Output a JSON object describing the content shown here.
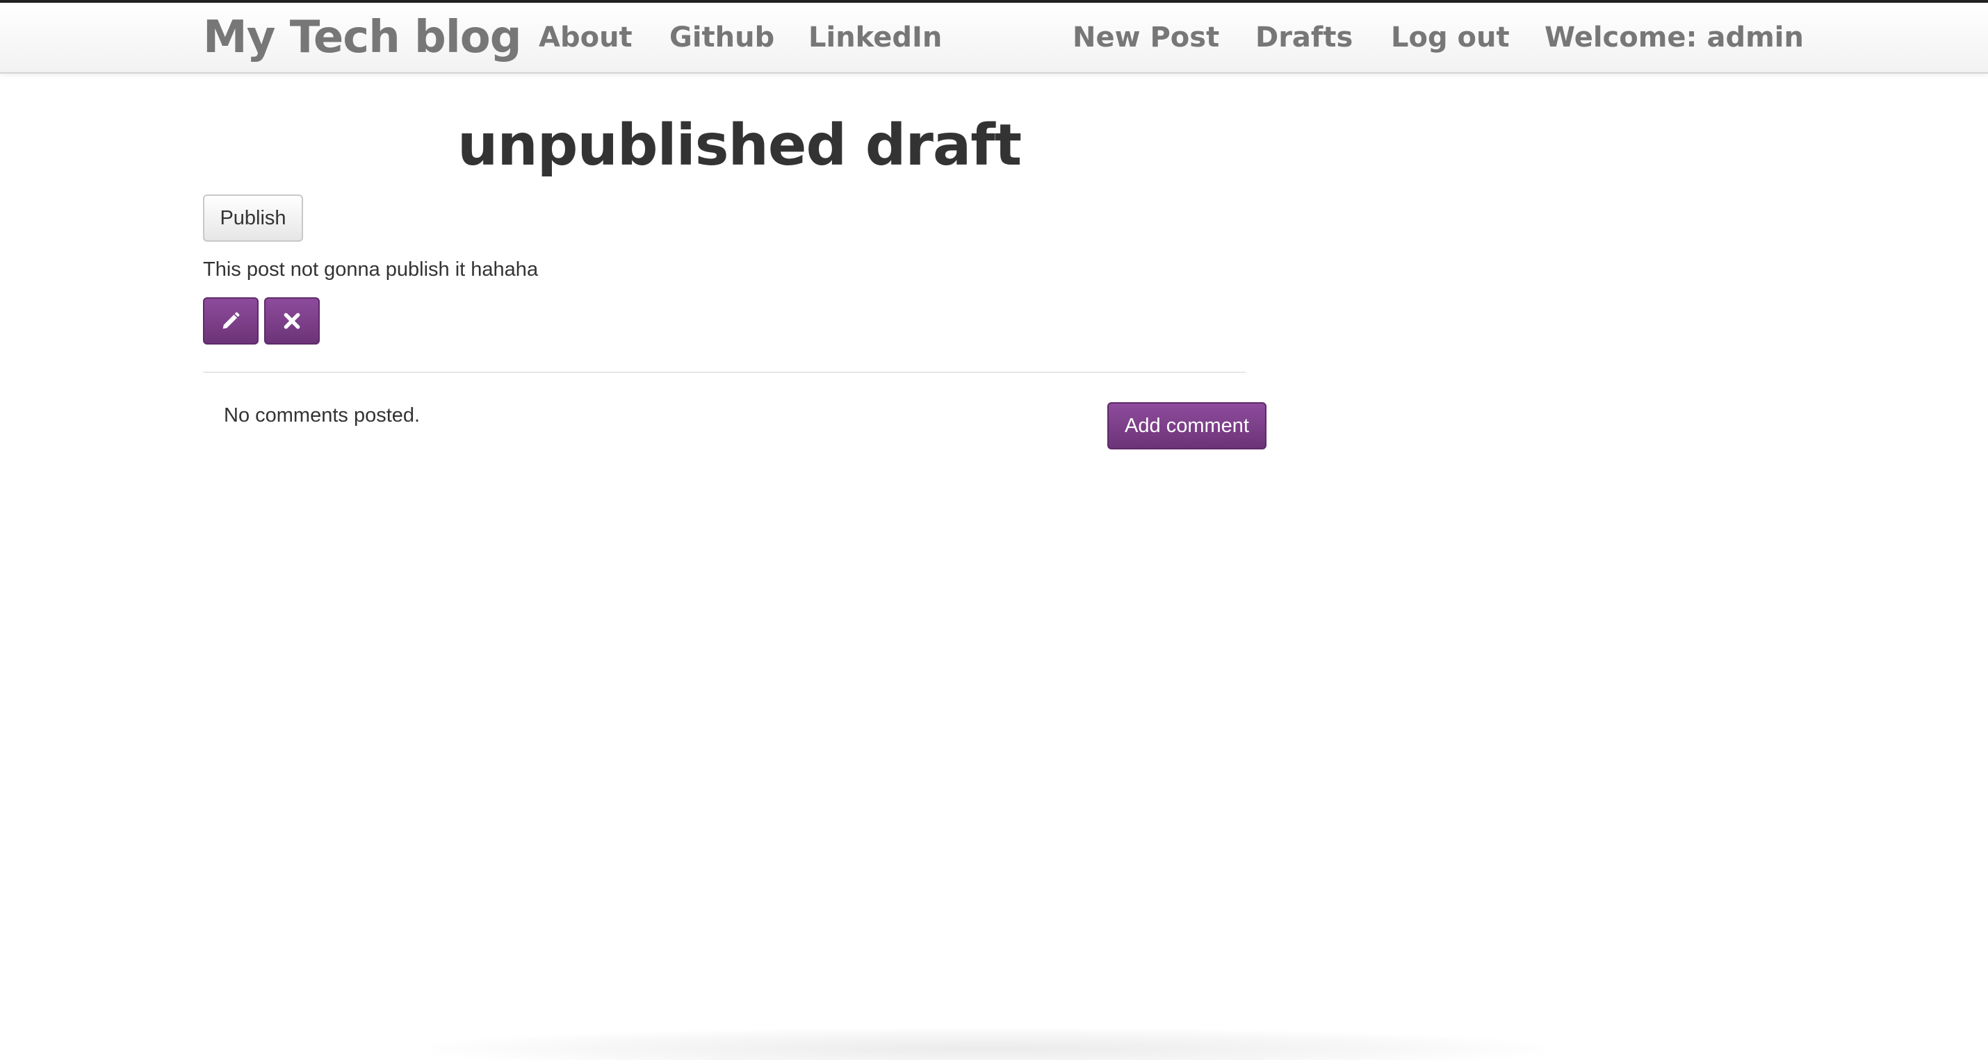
{
  "navbar": {
    "brand": "My Tech blog",
    "left_links": [
      "About",
      "Github",
      "LinkedIn"
    ],
    "right_links": [
      "New Post",
      "Drafts",
      "Log out"
    ],
    "welcome": "Welcome: admin"
  },
  "post": {
    "title": "unpublished draft",
    "publish_label": "Publish",
    "body": "This post not gonna publish it hahaha",
    "edit_icon": "pencil-icon",
    "delete_icon": "close-icon"
  },
  "comments": {
    "empty_text": "No comments posted.",
    "add_label": "Add comment"
  },
  "colors": {
    "accent": "#7b3f88",
    "nav_text": "#777777",
    "text": "#333333"
  }
}
